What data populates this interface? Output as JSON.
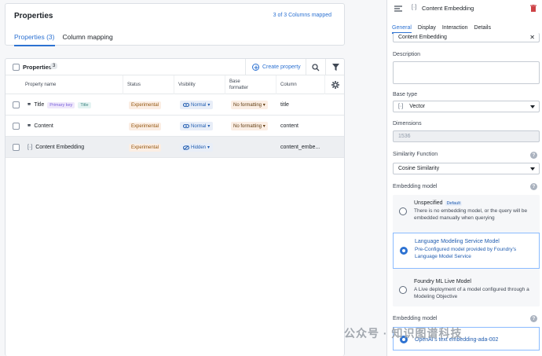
{
  "header": {
    "title": "Properties",
    "mapped": "3 of 3 Columns mapped",
    "tabs": [
      "Properties (3)",
      "Column mapping"
    ]
  },
  "table": {
    "toolbar_label": "Properties",
    "count": "3",
    "create_label": "Create property",
    "columns": [
      "Property name",
      "Status",
      "Visibility",
      "Base formatter",
      "Column"
    ],
    "rows": [
      {
        "name": "Title",
        "icon": "quote-icon",
        "tags": [
          "Primary key",
          "Title"
        ],
        "status": "Experimental",
        "visibility": "Normal",
        "formatter": "No formatting",
        "column": "title"
      },
      {
        "name": "Content",
        "icon": "quote-icon",
        "tags": [],
        "status": "Experimental",
        "visibility": "Normal",
        "formatter": "No formatting",
        "column": "content"
      },
      {
        "name": "Content Embedding",
        "icon": "vector-icon",
        "tags": [],
        "status": "Experimental",
        "visibility": "Hidden",
        "formatter": "",
        "column": "content_embe..."
      }
    ]
  },
  "panel": {
    "title": "Content Embedding",
    "tabs": [
      "General",
      "Display",
      "Interaction",
      "Details"
    ],
    "name_value": "Content Embedding",
    "description_label": "Description",
    "base_type_label": "Base type",
    "base_type_value": "Vector",
    "dimensions_label": "Dimensions",
    "dimensions_value": "1536",
    "similarity_label": "Similarity Function",
    "similarity_value": "Cosine Similarity",
    "embedding_label": "Embedding model",
    "options": [
      {
        "title": "Unspecified",
        "badge": "Default",
        "desc": "There is no embedding model, or the query will be embedded manually when querying"
      },
      {
        "title": "Language Modeling Service Model",
        "badge": "",
        "desc": "Pre-Configured model provided by Foundry's Language Model Service"
      },
      {
        "title": "Foundry ML Live Model",
        "badge": "",
        "desc": "A Live deployment of a model configured through a Modeling Objective"
      }
    ],
    "embedding_label_2": "Embedding model",
    "model_value": "OpenAI's text embedding-ada-002"
  },
  "watermark": "公众号 · 知识图谱科技",
  "colors": {
    "accent": "#2d72d2",
    "warning_bg": "#fbeee4",
    "delete": "#cd4246"
  }
}
